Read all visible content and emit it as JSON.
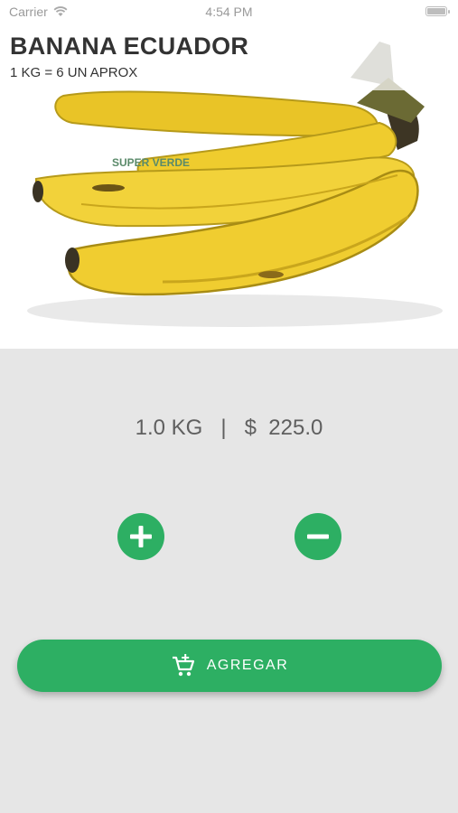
{
  "status_bar": {
    "carrier": "Carrier",
    "time": "4:54 PM"
  },
  "product": {
    "name": "BANANA ECUADOR",
    "subtitle": "1 KG = 6 UN APROX",
    "image_label": "SUPER VERDE"
  },
  "summary": {
    "quantity": "1.0 KG",
    "separator": "|",
    "price": "$  225.0"
  },
  "actions": {
    "increment_icon": "plus-icon",
    "decrement_icon": "minus-icon",
    "add_label": "AGREGAR",
    "add_icon": "cart-plus-icon"
  },
  "colors": {
    "accent": "#2daf63",
    "background": "#e6e6e6",
    "text": "#5f5f5f"
  }
}
